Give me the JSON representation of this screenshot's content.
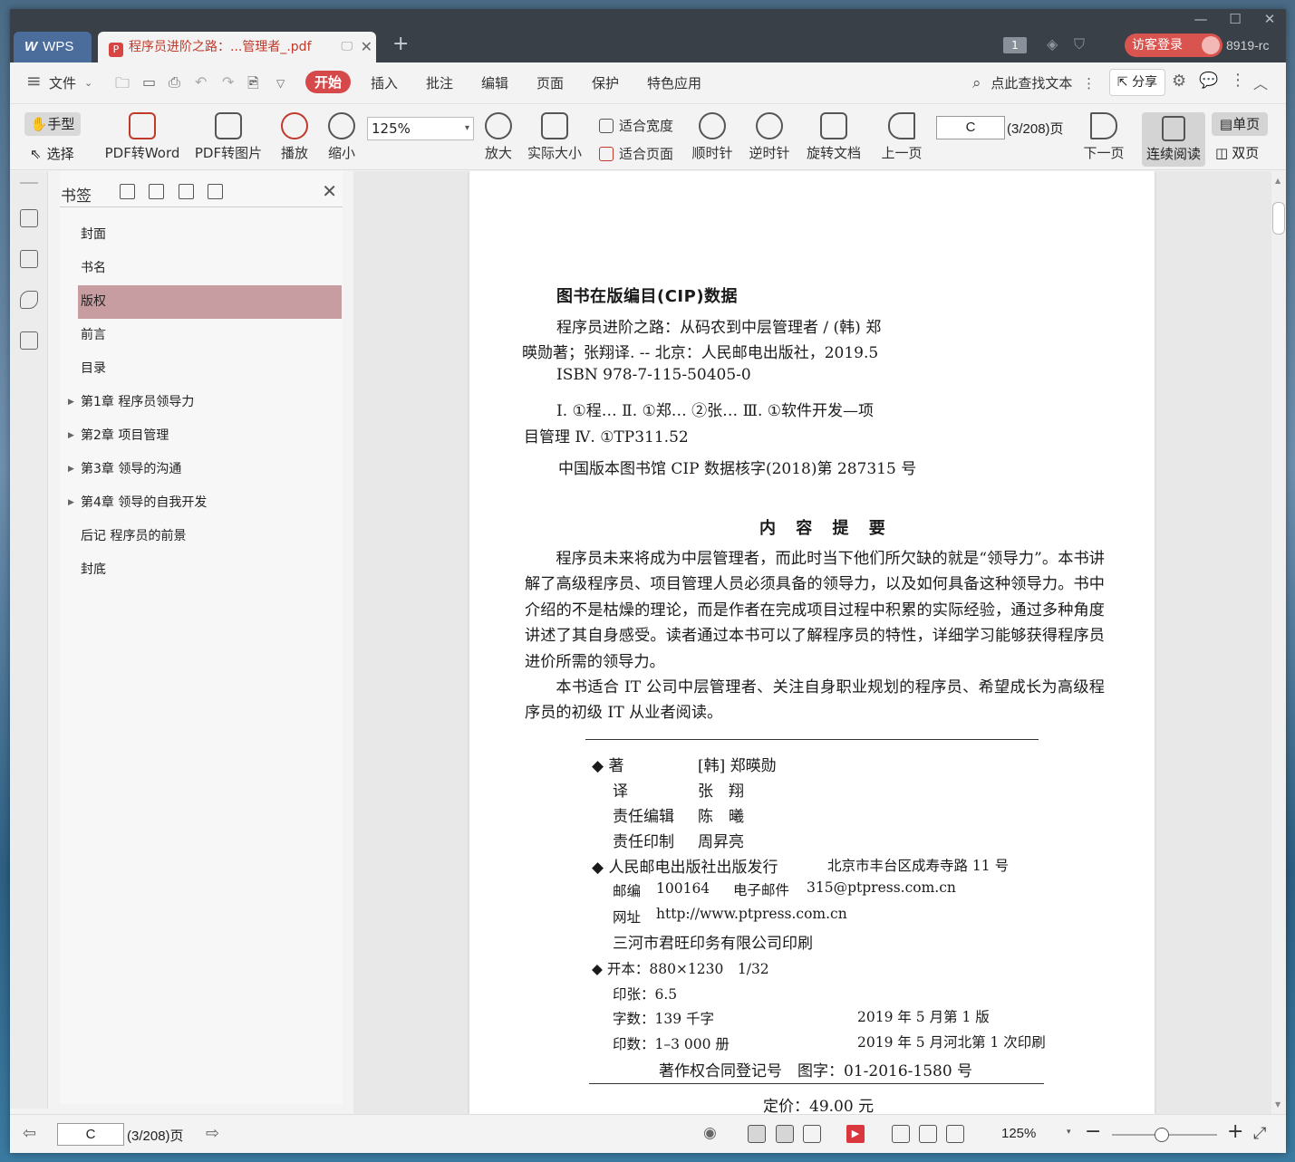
{
  "window": {
    "controls": {
      "minimize": "—",
      "maximize": "☐",
      "close": "✕"
    }
  },
  "titlebar": {
    "wps_tab": "WPS",
    "wps_logo": "W",
    "doc_tab_title": "程序员进阶之路：...管理者_.pdf",
    "pdf_icon": "P",
    "new_tab": "+",
    "close_tab": "✕",
    "monitor_icon": "🖵",
    "badge": "1",
    "login": "访客登录",
    "user": "8919-rc"
  },
  "menubar": {
    "hamburger": "≡",
    "file": "文件",
    "tabs": [
      "开始",
      "插入",
      "批注",
      "编辑",
      "页面",
      "保护",
      "特色应用"
    ],
    "active_tab": "开始",
    "search": "点此查找文本",
    "share": "分享"
  },
  "toolbar": {
    "hand": "手型",
    "select": "选择",
    "pdf_to_word": "PDF转Word",
    "pdf_to_image": "PDF转图片",
    "play": "播放",
    "zoom_out": "缩小",
    "zoom_value": "125%",
    "zoom_in": "放大",
    "actual_size": "实际大小",
    "fit_width": "适合宽度",
    "fit_page": "适合页面",
    "rotate_cw": "顺时针",
    "rotate_ccw": "逆时针",
    "rotate_doc": "旋转文档",
    "prev_page": "上一页",
    "page_input": "C",
    "page_count": "(3/208)页",
    "next_page": "下一页",
    "continuous": "连续阅读",
    "single": "单页",
    "double": "双页"
  },
  "bookmarks": {
    "title": "书签",
    "close": "✕",
    "items": [
      {
        "label": "封面",
        "expandable": false
      },
      {
        "label": "书名",
        "expandable": false
      },
      {
        "label": "版权",
        "expandable": false,
        "selected": true
      },
      {
        "label": "前言",
        "expandable": false
      },
      {
        "label": "目录",
        "expandable": false
      },
      {
        "label": "第1章  程序员领导力",
        "expandable": true
      },
      {
        "label": "第2章  项目管理",
        "expandable": true
      },
      {
        "label": "第3章  领导的沟通",
        "expandable": true
      },
      {
        "label": "第4章  领导的自我开发",
        "expandable": true
      },
      {
        "label": "后记  程序员的前景",
        "expandable": false
      },
      {
        "label": "封底",
        "expandable": false
      }
    ]
  },
  "page": {
    "cip_title": "图书在版编目(CIP)数据",
    "cip_line1": "程序员进阶之路：从码农到中层管理者 / (韩) 郑",
    "cip_line2": "暎勋著；张翔译. -- 北京：人民邮电出版社，2019.5",
    "isbn": "ISBN 978-7-115-50405-0",
    "class_line1": "Ⅰ. ①程… Ⅱ. ①郑… ②张… Ⅲ. ①软件开发—项",
    "class_line2": "目管理 Ⅳ. ①TP311.52",
    "cip_no": "中国版本图书馆 CIP 数据核字(2018)第 287315 号",
    "summary_title": "内 容 提 要",
    "summary_p1": "程序员未来将成为中层管理者，而此时当下他们所欠缺的就是“领导力”。本书讲解了高级程序员、项目管理人员必须具备的领导力，以及如何具备这种领导力。书中介绍的不是枯燥的理论，而是作者在完成项目过程中积累的实际经验，通过多种角度讲述了其自身感受。读者通过本书可以了解程序员的特性，详细学习能够获得程序员进价所需的领导力。",
    "summary_p2": "本书适合 IT 公司中层管理者、关注自身职业规划的程序员、希望成长为高级程序员的初级 IT 从业者阅读。",
    "credits": {
      "author_label": "◆ 著",
      "author": "[韩] 郑暎勋",
      "translator_label": "译",
      "translator": "张　翔",
      "editor_label": "责任编辑",
      "editor": "陈　曦",
      "printer_label": "责任印制",
      "printer": "周昇亮",
      "publisher": "◆ 人民邮电出版社出版发行",
      "address": "北京市丰台区成寿寺路 11 号",
      "postcode_label": "邮编",
      "postcode": "100164",
      "email_label": "电子邮件",
      "email": "315@ptpress.com.cn",
      "web_label": "网址",
      "web": "http://www.ptpress.com.cn",
      "print_house": "三河市君旺印务有限公司印刷",
      "format": "◆ 开本：880×1230　1/32",
      "sheets": "印张：6.5",
      "words": "字数：139 千字",
      "edition": "2019 年 5 月第 1 版",
      "copies": "印数：1–3 000 册",
      "printing": "2019 年 5 月河北第 1 次印刷",
      "copyright_reg": "著作权合同登记号　图字：01-2016-1580 号",
      "price": "定价：49.00 元"
    }
  },
  "statusbar": {
    "page_input": "C",
    "page_count": "(3/208)页",
    "zoom": "125%",
    "zoom_minus": "−",
    "zoom_plus": "+"
  },
  "colors": {
    "accent": "#d6494b",
    "selected_bookmark": "#c89da1",
    "titlebar": "#3a4048",
    "wps_tab": "#4a6d9c"
  }
}
